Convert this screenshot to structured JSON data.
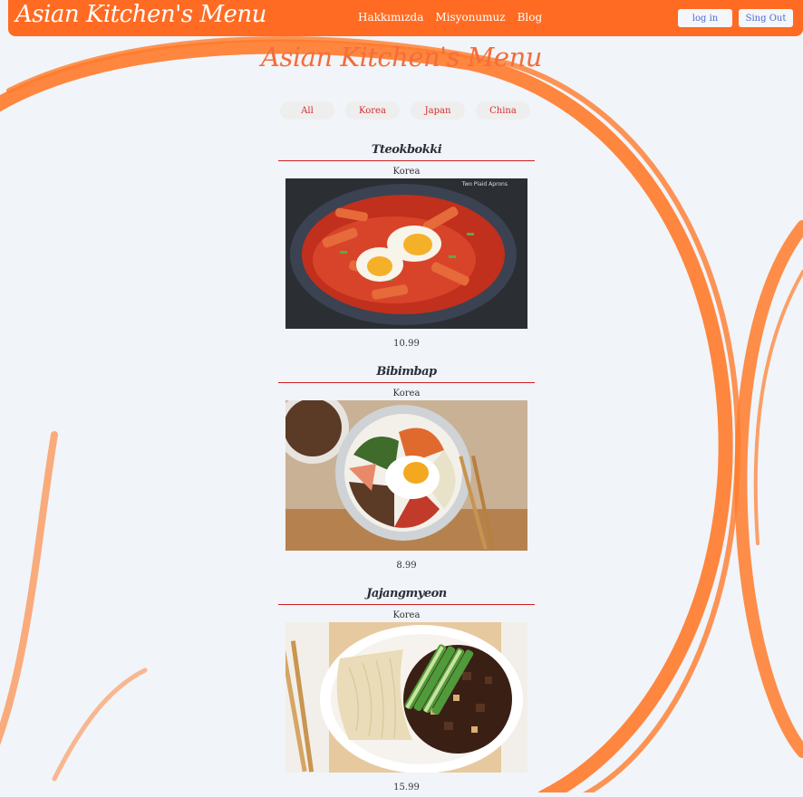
{
  "brand": "Asian Kitchen's Menu",
  "nav": {
    "links": [
      "Hakkımızda",
      "Misyonumuz",
      "Blog"
    ]
  },
  "auth": {
    "login_label": "log in",
    "logout_label": "Sing Out"
  },
  "page_title": "Asian Kitchen's Menu",
  "filters": [
    "All",
    "Korea",
    "Japan",
    "China"
  ],
  "colors": {
    "accent": "#ff6b22",
    "title": "#f46d3a",
    "divider": "#cf1f1f",
    "filter_text": "#d62d2d",
    "background": "#f1f4f8"
  },
  "menu": {
    "items": [
      {
        "title": "Tteokbokki",
        "category": "Korea",
        "price": "10.99",
        "image": "tteokbokki-photo",
        "watermark": "Two Plaid Aprons"
      },
      {
        "title": "Bibimbap",
        "category": "Korea",
        "price": "8.99",
        "image": "bibimbap-photo"
      },
      {
        "title": "Jajangmyeon",
        "category": "Korea",
        "price": "15.99",
        "image": "jajangmyeon-photo"
      }
    ]
  }
}
